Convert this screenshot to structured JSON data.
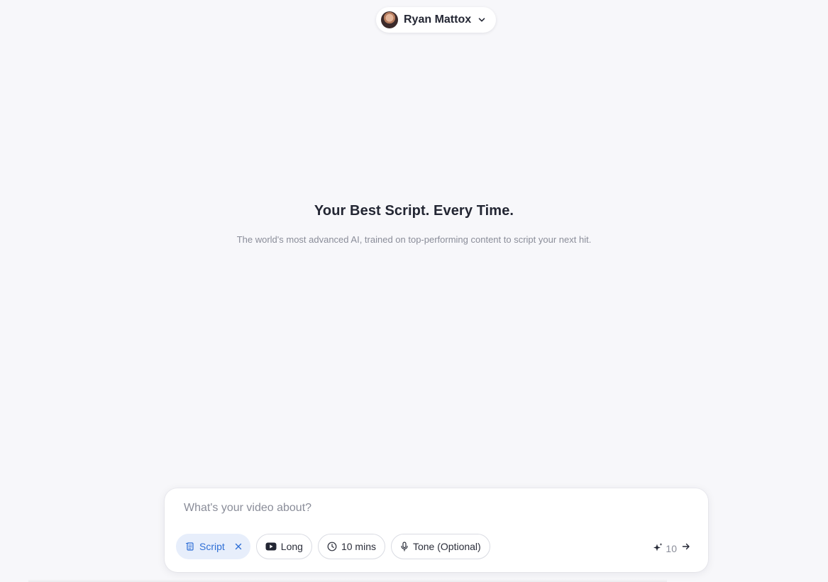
{
  "account": {
    "name": "Ryan Mattox",
    "avatar_icon": "user-avatar",
    "menu_icon": "chevron-down-icon"
  },
  "hero": {
    "title": "Your Best Script. Every Time.",
    "subtitle": "The world's most advanced AI, trained on top-performing content to script your next hit."
  },
  "composer": {
    "placeholder": "What's your video about?",
    "value": "",
    "chips": {
      "mode": {
        "label": "Script",
        "icon": "script-icon",
        "active": true,
        "removable": true
      },
      "format": {
        "label": "Long",
        "icon": "youtube-icon"
      },
      "duration": {
        "label": "10 mins",
        "icon": "clock-icon"
      },
      "tone": {
        "label": "Tone (Optional)",
        "icon": "microphone-icon"
      }
    },
    "credits": "10",
    "credits_icon": "sparkle-icon",
    "send_icon": "arrow-right-icon"
  },
  "colors": {
    "background": "#f7f7fa",
    "accent": "#2f6fd6",
    "accent_bg": "#e7eefb",
    "text_primary": "#232633",
    "text_muted": "#8a8d99"
  }
}
